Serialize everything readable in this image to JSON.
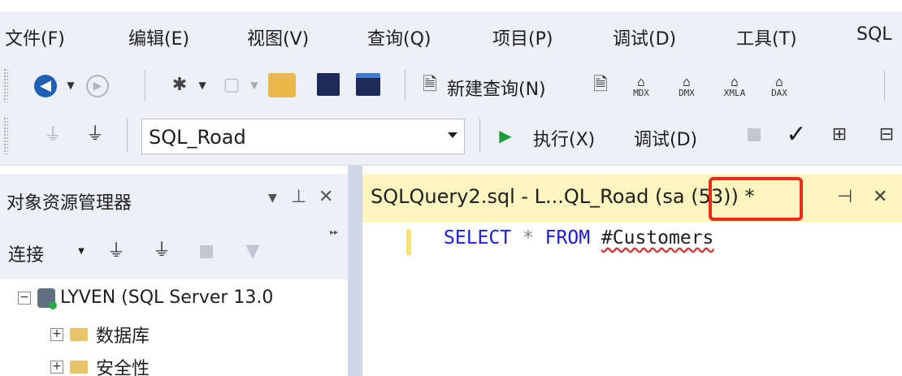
{
  "menu": {
    "items": [
      "文件(F)",
      "编辑(E)",
      "视图(V)",
      "查询(Q)",
      "项目(P)",
      "调试(D)",
      "工具(T)",
      "SQL"
    ]
  },
  "toolbar1": {
    "new_query_label": "新建查询(N)",
    "analysis_labels": [
      "MDX",
      "DMX",
      "XMLA",
      "DAX"
    ]
  },
  "toolbar2": {
    "database": "SQL_Road",
    "execute_label": "执行(X)",
    "debug_label": "调试(D)"
  },
  "object_explorer": {
    "title": "对象资源管理器",
    "connect_label": "连接",
    "tree": {
      "server": "LYVEN (SQL Server 13.0",
      "children": [
        "数据库",
        "安全性"
      ]
    }
  },
  "document": {
    "tab_title_main": "SQLQuery2.sql - L...QL_Road ",
    "tab_session": "(sa (53))",
    "tab_dirty": " *",
    "code": {
      "kw1": "SELECT",
      "star": "*",
      "kw2": "FROM",
      "table": "#Customers"
    }
  },
  "colors": {
    "chrome": "#eef0f7",
    "tab_active": "#fdf4bf",
    "highlight_box": "#ea2a1c",
    "keyword": "#1a1af5"
  }
}
